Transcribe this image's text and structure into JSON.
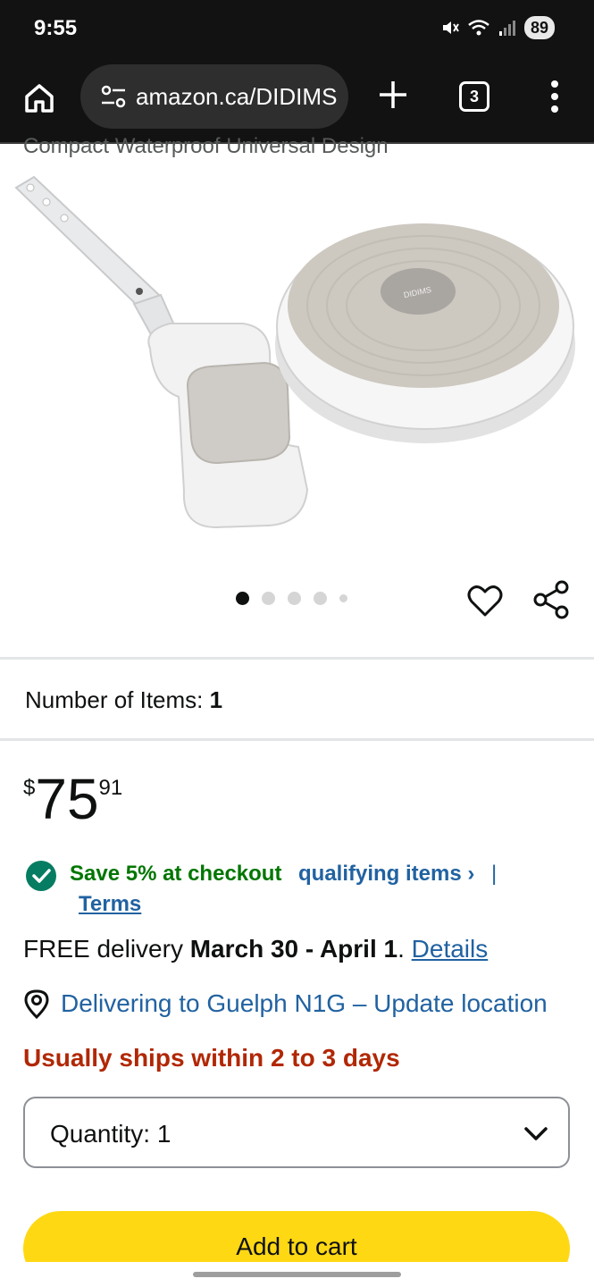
{
  "status_bar": {
    "time": "9:55",
    "battery": "89"
  },
  "browser": {
    "url": "amazon.ca/DIDIMS",
    "tab_count": "3"
  },
  "product": {
    "caption": "Compact Waterproof Universal Design",
    "image_brand": "DIDIMS",
    "carousel": {
      "total": 5,
      "active": 1
    }
  },
  "number_of_items": {
    "label": "Number of Items:",
    "value": "1"
  },
  "price": {
    "symbol": "$",
    "whole": "75",
    "fraction": "91"
  },
  "promo": {
    "save_text": "Save 5% at checkout",
    "qualifying_link": "qualifying items ›",
    "separator": "|",
    "terms_link": "Terms"
  },
  "delivery": {
    "prefix": "FREE delivery ",
    "dates": "March 30 - April 1",
    "suffix": ". ",
    "details_link": "Details"
  },
  "location": {
    "text": "Delivering to Guelph N1G – Update location"
  },
  "shipping": {
    "text": "Usually ships within 2 to 3 days"
  },
  "quantity": {
    "label": "Quantity:",
    "value": "1"
  },
  "cart": {
    "add_label": "Add to cart"
  },
  "colors": {
    "primary_text": "#0f1111",
    "link": "#2162a1",
    "promo_green": "#007600",
    "ships_red": "#b12704",
    "cart_yellow": "#ffd814",
    "browser_dark": "#121212"
  }
}
